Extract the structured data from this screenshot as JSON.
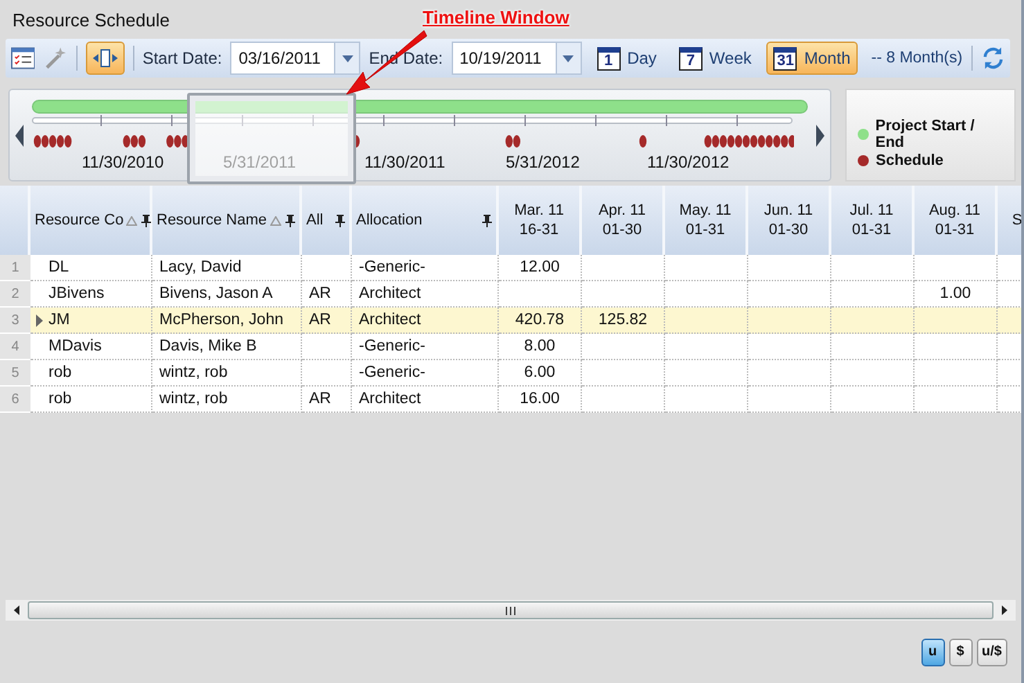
{
  "window": {
    "title": "Resource Schedule"
  },
  "annotation": {
    "text": "Timeline Window"
  },
  "toolbar": {
    "start_label": "Start Date:",
    "start_value": "03/16/2011",
    "end_label": "End Date:",
    "end_value": "10/19/2011",
    "views": [
      {
        "day_number": "1",
        "label": "Day",
        "selected": false
      },
      {
        "day_number": "7",
        "label": "Week",
        "selected": false
      },
      {
        "day_number": "31",
        "label": "Month",
        "selected": true
      }
    ],
    "span": "-- 8 Month(s)",
    "timeline_toggle_on": true
  },
  "timeline": {
    "labels": [
      "11/30/2010",
      "5/31/2011",
      "11/30/2011",
      "5/31/2012",
      "11/30/2012"
    ]
  },
  "legend": [
    {
      "label": "Project Start / End",
      "color": "#8ee08a"
    },
    {
      "label": "Schedule",
      "color": "#a52a2a"
    }
  ],
  "grid": {
    "columns": [
      {
        "title": "Resource Co",
        "sort": true,
        "pin": true
      },
      {
        "title": "Resource Name",
        "sort": true,
        "pin": true
      },
      {
        "title": "All",
        "sort": false,
        "pin": true
      },
      {
        "title": "Allocation",
        "sort": false,
        "pin": true
      }
    ],
    "periods": [
      {
        "month": "Mar. 11",
        "days": "16-31"
      },
      {
        "month": "Apr. 11",
        "days": "01-30"
      },
      {
        "month": "May. 11",
        "days": "01-31"
      },
      {
        "month": "Jun. 11",
        "days": "01-30"
      },
      {
        "month": "Jul. 11",
        "days": "01-31"
      },
      {
        "month": "Aug. 11",
        "days": "01-31"
      },
      {
        "month": "S"
      }
    ],
    "rows": [
      {
        "number": "1",
        "selected": false,
        "code": "DL",
        "name": "Lacy, David",
        "allocation": "-Generic-",
        "values": {
          "column_1": "12.00"
        }
      },
      {
        "number": "2",
        "selected": false,
        "code": "JBivens",
        "name": "Bivens, Jason A",
        "all": "AR",
        "allocation": "Architect",
        "values": {
          "column_6": "1.00"
        }
      },
      {
        "number": "3",
        "selected": true,
        "code": "JM",
        "name": "McPherson, John",
        "all": "AR",
        "allocation": "Architect",
        "values": {
          "column_1": "420.78",
          "column_2": "125.82"
        }
      },
      {
        "number": "4",
        "selected": false,
        "code": "MDavis",
        "name": "Davis, Mike B",
        "allocation": "-Generic-",
        "values": {
          "column_1": "8.00"
        }
      },
      {
        "number": "5",
        "selected": false,
        "code": "rob",
        "name": "wintz, rob",
        "allocation": "-Generic-",
        "values": {
          "column_1": "6.00"
        }
      },
      {
        "number": "6",
        "selected": false,
        "code": "rob",
        "name": "wintz, rob",
        "all": "AR",
        "allocation": "Architect",
        "values": {
          "column_1": "16.00"
        }
      }
    ]
  },
  "units": [
    {
      "label": "u",
      "selected": true
    },
    {
      "label": "$",
      "selected": false
    },
    {
      "label": "u/$",
      "selected": false
    }
  ]
}
